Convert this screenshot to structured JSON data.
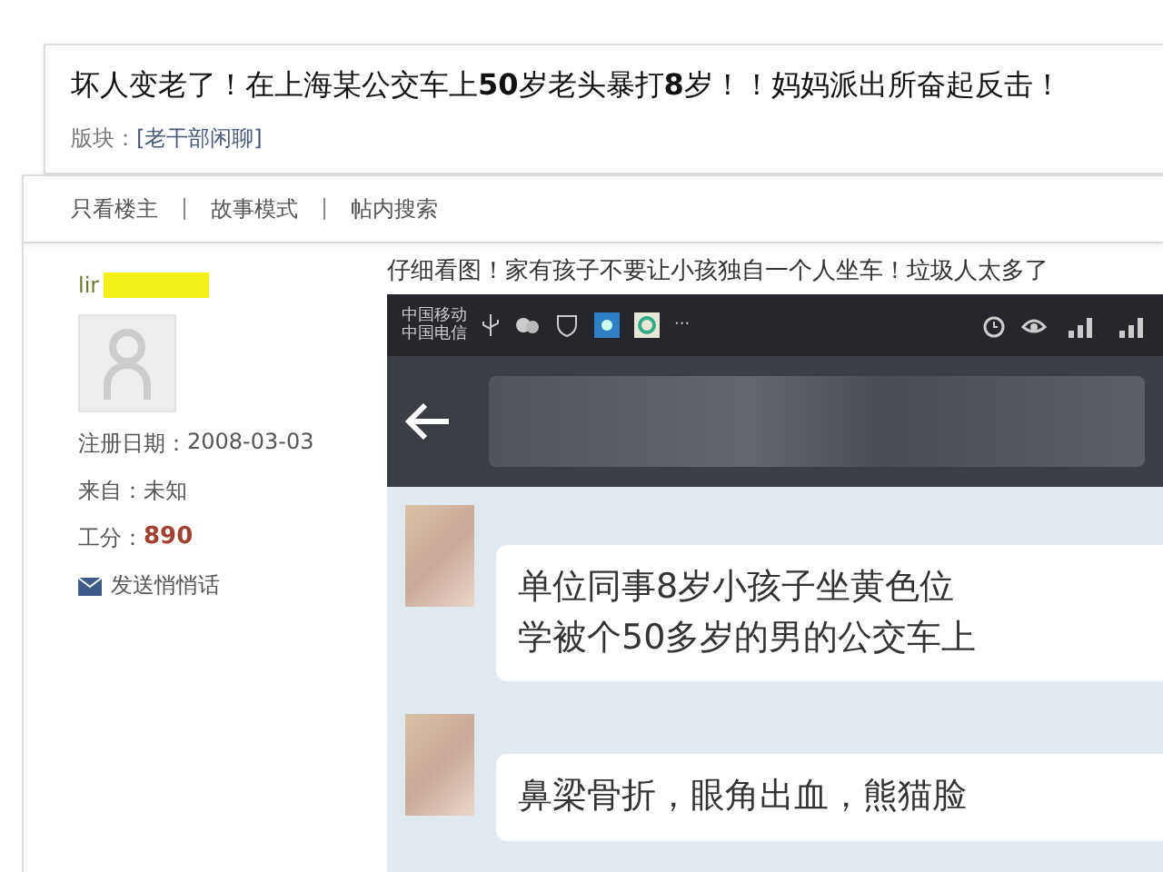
{
  "thread": {
    "title": "坏人变老了！在上海某公交车上**50**岁老头暴打**8**岁！！妈妈派出所奋起反击！",
    "board_label": "版块：",
    "board": "[老干部闲聊]"
  },
  "toolbar": [
    "只看楼主",
    "故事模式",
    "帖内搜索"
  ],
  "author": {
    "name": "lir",
    "info": [
      {
        "label": "注册日期：",
        "value": "2008-03-03",
        "kind": "plain"
      },
      {
        "label": "来自：",
        "value": "未知",
        "kind": "plain"
      },
      {
        "label": "工分：",
        "value": "890",
        "kind": "score"
      }
    ],
    "message_link": "发送悄悄话"
  },
  "post": {
    "text": "仔细看图！家有孩子不要让小孩独自一个人坐车！垃圾人太多了",
    "phone": {
      "carriers": [
        "中国移动",
        "中国电信"
      ],
      "more": "···",
      "messages": [
        {
          "lines": [
            "单位同事8岁小孩子坐黄色位",
            "学被个50多岁的男的公交车上"
          ]
        },
        {
          "lines": [
            "鼻梁骨折，眼角出血，熊猫脸"
          ]
        }
      ]
    }
  }
}
